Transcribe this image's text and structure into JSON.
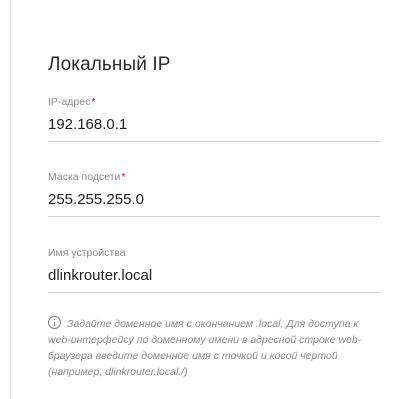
{
  "section": {
    "title": "Локальный IP"
  },
  "fields": {
    "ip": {
      "label": "IP-адрес",
      "required_mark": "*",
      "value": "192.168.0.1"
    },
    "mask": {
      "label": "Маска подсети",
      "required_mark": "*",
      "value": "255.255.255.0"
    },
    "device_name": {
      "label": "Имя устройства",
      "value": "dlinkrouter.local"
    }
  },
  "hint": {
    "icon": "info-icon",
    "text": "Задайте доменное имя с окончанием .local. Для доступа к web-интерфейсу по доменному имени в адресной строке web-браузера введите доменное имя с точкой и косой чертой (например, dlinkrouter.local./)"
  },
  "colors": {
    "required": "#e2001a",
    "label": "#8a8a8a",
    "text": "#222222",
    "underline": "#cfcfcf"
  }
}
